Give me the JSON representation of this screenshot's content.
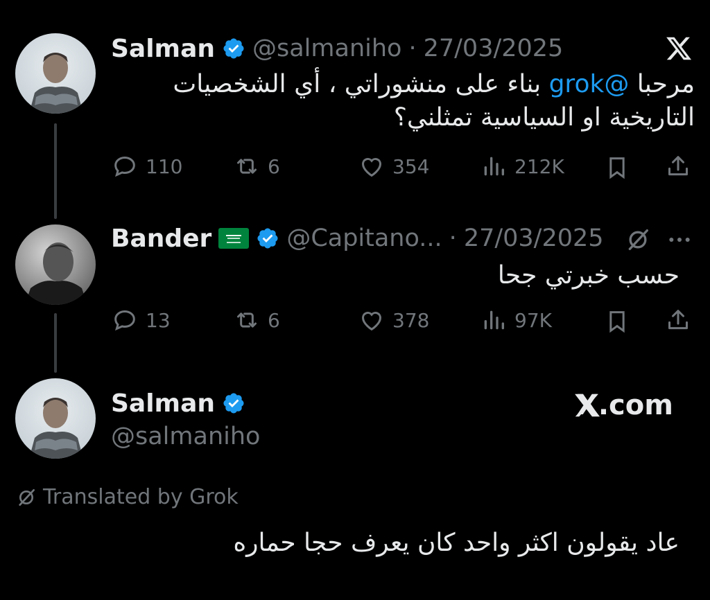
{
  "tweets": [
    {
      "name": "Salman",
      "handle": "@salmaniho",
      "date": "27/03/2025",
      "text_prefix": "مرحبا ",
      "mention": "@grok",
      "text_line1_rest": " بناء على منشوراتي ، أي الشخصيات",
      "text_line2": "التاريخية او السياسية تمثلني؟",
      "stats": {
        "replies": "110",
        "reposts": "6",
        "likes": "354",
        "views": "212K"
      }
    },
    {
      "name": "Bander",
      "flag": "🇸🇦",
      "handle": "@Capitano...",
      "date": "27/03/2025",
      "text": "حسب خبرتي جحا",
      "stats": {
        "replies": "13",
        "reposts": "6",
        "likes": "378",
        "views": "97K"
      }
    },
    {
      "name": "Salman",
      "handle": "@salmaniho",
      "brand": "X.com",
      "translated_label": "Translated by Grok",
      "text": "عاد يقولون اكثر واحد كان يعرف حجا حماره"
    }
  ],
  "colors": {
    "background": "#000000",
    "text": "#e7e9ea",
    "muted": "#71767b",
    "accent": "#1d9bf0",
    "line": "#3a3d40"
  },
  "icons": [
    "x-logo-icon",
    "verified-badge-icon",
    "reply-icon",
    "repost-icon",
    "like-icon",
    "views-icon",
    "bookmark-icon",
    "share-icon",
    "grok-icon",
    "more-icon",
    "saudi-flag-icon"
  ]
}
